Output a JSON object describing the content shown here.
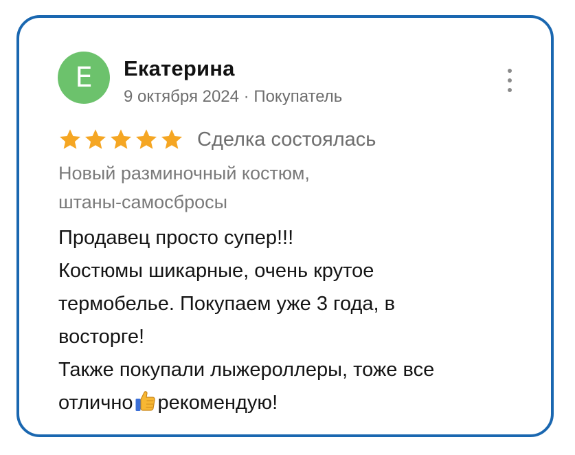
{
  "review": {
    "author": {
      "initial": "Е",
      "name": "Екатерина",
      "avatar_color": "#6cc26c"
    },
    "date": "9 октября 2024",
    "separator": " · ",
    "role": "Покупатель",
    "rating": 5,
    "rating_max": 5,
    "star_color": "#f5a623",
    "status": "Сделка состоялась",
    "product_lines": [
      "Новый разминочный костюм,",
      "штаны-самосбросы"
    ],
    "text_lines": [
      "Продавец просто супер!!!",
      "Костюмы шикарные, очень крутое",
      "термобелье. Покупаем уже 3 года, в",
      "восторге!",
      "Также покупали лыжероллеры, тоже все",
      "отлично",
      "рекомендую!"
    ],
    "emoji": "thumbs-up-icon",
    "border_color": "#1a67b0"
  }
}
